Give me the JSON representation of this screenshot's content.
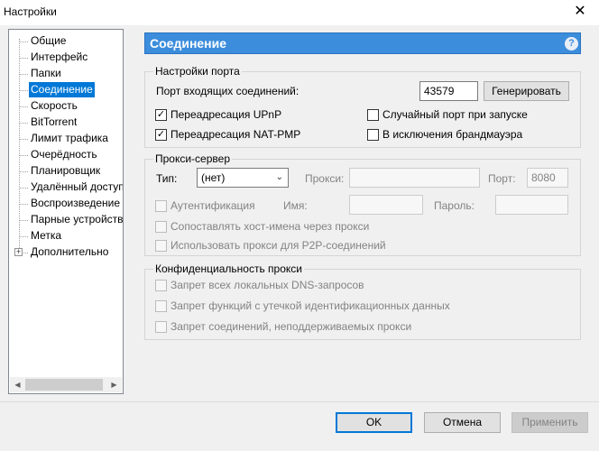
{
  "window": {
    "title": "Настройки"
  },
  "tree": {
    "items": [
      {
        "label": "Общие"
      },
      {
        "label": "Интерфейс"
      },
      {
        "label": "Папки"
      },
      {
        "label": "Соединение",
        "selected": true
      },
      {
        "label": "Скорость"
      },
      {
        "label": "BitTorrent"
      },
      {
        "label": "Лимит трафика"
      },
      {
        "label": "Очерёдность"
      },
      {
        "label": "Планировщик"
      },
      {
        "label": "Удалённый доступ"
      },
      {
        "label": "Воспроизведение"
      },
      {
        "label": "Парные устройства"
      },
      {
        "label": "Метка"
      },
      {
        "label": "Дополнительно",
        "expandable": true
      }
    ],
    "expand_glyph": "+"
  },
  "header": {
    "title": "Соединение",
    "help_glyph": "?"
  },
  "port": {
    "group_title": "Настройки порта",
    "incoming_label": "Порт входящих соединений:",
    "incoming_value": "43579",
    "generate_label": "Генерировать",
    "upnp_label": "Переадресация UPnP",
    "upnp_checked": true,
    "natpmp_label": "Переадресация NAT-PMP",
    "natpmp_checked": true,
    "random_label": "Случайный порт при запуске",
    "random_checked": false,
    "firewall_label": "В исключения брандмауэра",
    "firewall_checked": false
  },
  "proxy": {
    "group_title": "Прокси-сервер",
    "type_label": "Тип:",
    "type_value": "(нет)",
    "proxy_label": "Прокси:",
    "proxy_value": "",
    "port_label": "Порт:",
    "port_value": "8080",
    "auth_label": "Аутентификация",
    "name_label": "Имя:",
    "password_label": "Пароль:",
    "resolve_label": "Сопоставлять хост-имена через прокси",
    "p2p_label": "Использовать прокси для P2P-соединений"
  },
  "privacy": {
    "group_title": "Конфиденциальность прокси",
    "dns_label": "Запрет всех локальных DNS-запросов",
    "leak_label": "Запрет функций с утечкой идентификационных данных",
    "unsupported_label": "Запрет соединений, неподдерживаемых прокси"
  },
  "buttons": {
    "ok": "OK",
    "cancel": "Отмена",
    "apply": "Применить"
  },
  "icons": {
    "close": "✕",
    "check": "✓",
    "dropdown": "chevron-down-icon"
  },
  "colors": {
    "accent": "#3c8ddc",
    "selection": "#0078d7"
  }
}
